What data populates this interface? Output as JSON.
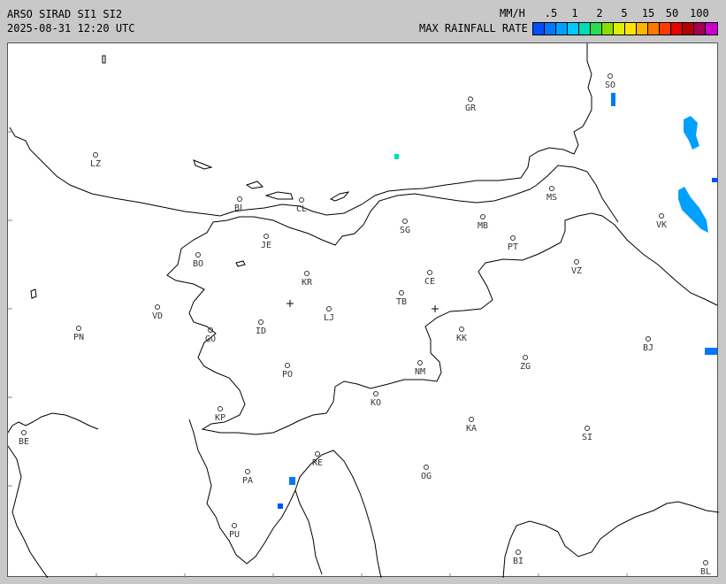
{
  "header": {
    "title": "ARSO SIRAD SI1 SI2",
    "datetime": "2025-08-31 12:20 UTC"
  },
  "legend": {
    "units": "MM/H",
    "label": "MAX RAINFALL RATE",
    "ticks": [
      ".5",
      "1",
      "2",
      "5",
      "15",
      "50",
      "100"
    ],
    "colors": [
      "#0050ff",
      "#0078ff",
      "#00a0ff",
      "#00c8ff",
      "#00dcb4",
      "#28dc50",
      "#8cdc00",
      "#dcf000",
      "#ffe600",
      "#ffb400",
      "#ff7800",
      "#ff3c00",
      "#e60000",
      "#b40000",
      "#a00050",
      "#c800c8"
    ]
  },
  "map": {
    "stations": [
      {
        "code": "SO",
        "label": "SO"
      },
      {
        "code": "GR",
        "label": "GR"
      },
      {
        "code": "LZ",
        "label": "LZ"
      },
      {
        "code": "MS",
        "label": "MS"
      },
      {
        "code": "BL",
        "label": "BL"
      },
      {
        "code": "CL",
        "label": "CL"
      },
      {
        "code": "MB",
        "label": "MB"
      },
      {
        "code": "VK",
        "label": "VK"
      },
      {
        "code": "SG",
        "label": "SG"
      },
      {
        "code": "JE",
        "label": "JE"
      },
      {
        "code": "PT",
        "label": "PT"
      },
      {
        "code": "BO",
        "label": "BO"
      },
      {
        "code": "KR",
        "label": "KR"
      },
      {
        "code": "CE",
        "label": "CE"
      },
      {
        "code": "VZ",
        "label": "VZ"
      },
      {
        "code": "TB",
        "label": "TB"
      },
      {
        "code": "VD",
        "label": "VD"
      },
      {
        "code": "LJ",
        "label": "LJ"
      },
      {
        "code": "PN",
        "label": "PN"
      },
      {
        "code": "ID",
        "label": "ID"
      },
      {
        "code": "GO",
        "label": "GO"
      },
      {
        "code": "KK",
        "label": "KK"
      },
      {
        "code": "BJ",
        "label": "BJ"
      },
      {
        "code": "ZG",
        "label": "ZG"
      },
      {
        "code": "NM",
        "label": "NM"
      },
      {
        "code": "PO",
        "label": "PO"
      },
      {
        "code": "KO",
        "label": "KO"
      },
      {
        "code": "KP",
        "label": "KP"
      },
      {
        "code": "KA",
        "label": "KA"
      },
      {
        "code": "SI",
        "label": "SI"
      },
      {
        "code": "BE",
        "label": "BE"
      },
      {
        "code": "RE",
        "label": "RE"
      },
      {
        "code": "PA",
        "label": "PA"
      },
      {
        "code": "OG",
        "label": "OG"
      },
      {
        "code": "PU",
        "label": "PU"
      },
      {
        "code": "BI",
        "label": "BI"
      },
      {
        "code": "BL2",
        "label": "BL"
      }
    ]
  }
}
